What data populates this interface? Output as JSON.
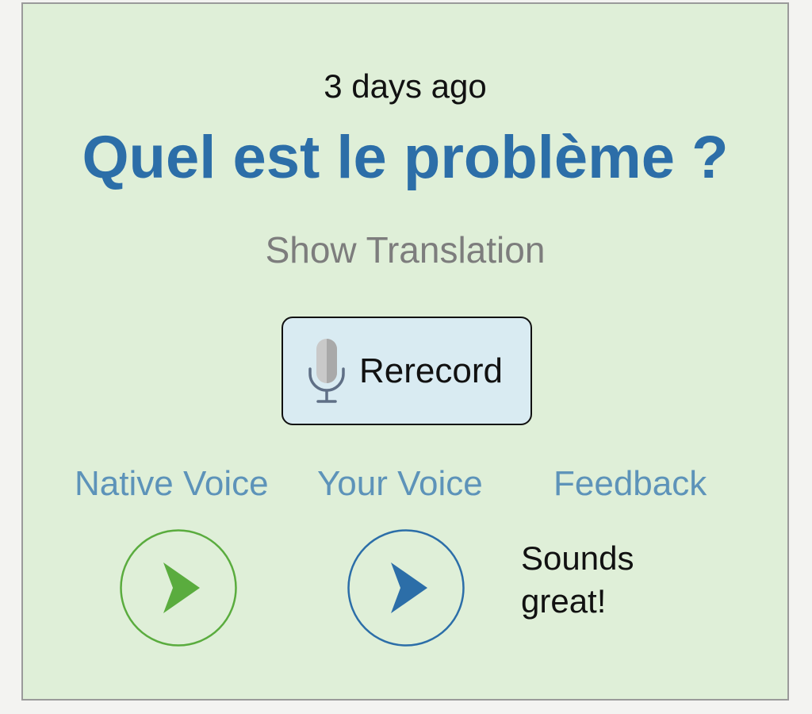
{
  "card": {
    "timestamp": "3 days ago",
    "phrase": "Quel est le problème ?",
    "show_translation_label": "Show Translation"
  },
  "record_button": {
    "label": "Rerecord",
    "icon": "microphone-icon"
  },
  "columns": {
    "native_voice_label": "Native Voice",
    "your_voice_label": "Your Voice",
    "feedback_label": "Feedback"
  },
  "feedback": {
    "text": "Sounds great!"
  },
  "colors": {
    "card_background": "#dfefd8",
    "phrase": "#2c6ea8",
    "column_label": "#5d93b9",
    "native_play": "#5aac3e",
    "your_play": "#2c6ea8",
    "record_button_background": "#d9ebf2"
  }
}
